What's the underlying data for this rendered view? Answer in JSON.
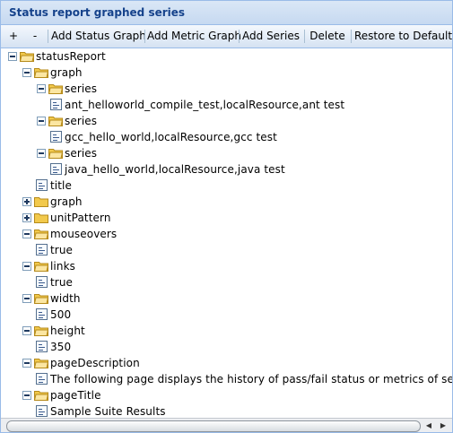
{
  "panel": {
    "title": "Status report graphed series"
  },
  "toolbar": {
    "buttons": [
      {
        "label": "+"
      },
      {
        "label": "-"
      },
      {
        "label": "Add Status Graph"
      },
      {
        "label": "Add Metric Graph"
      },
      {
        "label": "Add Series"
      },
      {
        "label": "Delete"
      },
      {
        "label": "Restore to Defaults"
      }
    ]
  },
  "tree": {
    "nodes": [
      {
        "label": "statusReport",
        "type": "folder",
        "expanded": true,
        "level": 0
      },
      {
        "label": "graph",
        "type": "folder",
        "expanded": true,
        "level": 1
      },
      {
        "label": "series",
        "type": "folder",
        "expanded": true,
        "level": 2
      },
      {
        "label": "ant_helloworld_compile_test,localResource,ant test",
        "type": "leaf",
        "level": 3
      },
      {
        "label": "series",
        "type": "folder",
        "expanded": true,
        "level": 2
      },
      {
        "label": "gcc_hello_world,localResource,gcc test",
        "type": "leaf",
        "level": 3
      },
      {
        "label": "series",
        "type": "folder",
        "expanded": true,
        "level": 2
      },
      {
        "label": "java_hello_world,localResource,java test",
        "type": "leaf",
        "level": 3
      },
      {
        "label": "title",
        "type": "leaf",
        "level": 2
      },
      {
        "label": "graph",
        "type": "folder",
        "expanded": false,
        "level": 1
      },
      {
        "label": "unitPattern",
        "type": "folder",
        "expanded": false,
        "level": 1
      },
      {
        "label": "mouseovers",
        "type": "folder",
        "expanded": true,
        "level": 1
      },
      {
        "label": "true",
        "type": "leaf",
        "level": 2
      },
      {
        "label": "links",
        "type": "folder",
        "expanded": true,
        "level": 1
      },
      {
        "label": "true",
        "type": "leaf",
        "level": 2
      },
      {
        "label": "width",
        "type": "folder",
        "expanded": true,
        "level": 1
      },
      {
        "label": "500",
        "type": "leaf",
        "level": 2
      },
      {
        "label": "height",
        "type": "folder",
        "expanded": true,
        "level": 1
      },
      {
        "label": "350",
        "type": "leaf",
        "level": 2
      },
      {
        "label": "pageDescription",
        "type": "folder",
        "expanded": true,
        "level": 1
      },
      {
        "label": "The following page displays the history of pass/fail status or metrics of sele",
        "type": "leaf",
        "level": 2
      },
      {
        "label": "pageTitle",
        "type": "folder",
        "expanded": true,
        "level": 1
      },
      {
        "label": "Sample Suite Results",
        "type": "leaf",
        "level": 2
      }
    ]
  },
  "scrollbar": {
    "left_arrow": "◀",
    "right_arrow": "▶"
  },
  "colors": {
    "header_text": "#15428b",
    "border": "#99bbe8",
    "folder": "#f2c94c"
  }
}
